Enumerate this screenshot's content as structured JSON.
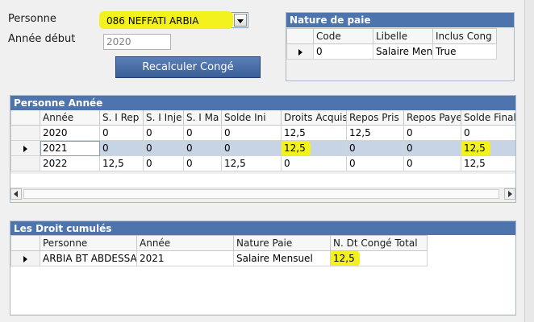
{
  "form": {
    "personne_label": "Personne",
    "personne_value": "086 NEFFATI ARBIA",
    "annee_label": "Année début",
    "annee_value": "2020",
    "recalc_label": "Recalculer Congé"
  },
  "nature": {
    "title": "Nature de paie",
    "headers": [
      "Code",
      "Libelle",
      "Inclus Cong"
    ],
    "rows": [
      [
        "0",
        "Salaire Men",
        "True"
      ]
    ]
  },
  "annee_grid": {
    "title": "Personne Année",
    "headers": [
      "Année",
      "S. I Rep",
      "S. I Inje",
      "S. I Ma",
      "Solde Ini",
      "Droits Acquis",
      "Repos Pris",
      "Repos Paye",
      "Solde Final"
    ],
    "rows": [
      [
        "2020",
        "0",
        "0",
        "0",
        "0",
        "12,5",
        "12,5",
        "0",
        "0"
      ],
      [
        "2021",
        "0",
        "0",
        "0",
        "0",
        "12,5",
        "0",
        "0",
        "12,5"
      ],
      [
        "2022",
        "12,5",
        "0",
        "0",
        "12,5",
        "0",
        "0",
        "0",
        "12,5"
      ]
    ]
  },
  "cumul": {
    "title": "Les Droit cumulés",
    "headers": [
      "Personne",
      "Année",
      "Nature Paie",
      "N. Dt Congé Total"
    ],
    "rows": [
      [
        "ARBIA BT ABDESSA",
        "2021",
        "Salaire Mensuel",
        "12,5"
      ]
    ]
  },
  "colors": {
    "accent": "#4e74ad",
    "highlight": "#f4f21e",
    "selected_row": "#c6d4e6"
  }
}
